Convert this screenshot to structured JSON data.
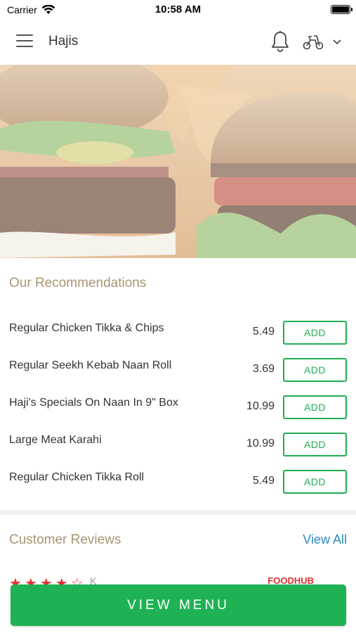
{
  "status_bar": {
    "carrier": "Carrier",
    "time": "10:58 AM",
    "battery_level": 1.0
  },
  "header": {
    "title": "Hajis",
    "icons": [
      "menu-icon",
      "bell-icon",
      "scooter-icon",
      "chevron-down-icon"
    ]
  },
  "recommendations": {
    "title": "Our Recommendations",
    "add_label": "ADD",
    "items": [
      {
        "name": "Regular Chicken Tikka & Chips",
        "price": "5.49"
      },
      {
        "name": "Regular Seekh Kebab Naan Roll",
        "price": "3.69"
      },
      {
        "name": "Haji's Specials On Naan In 9\" Box",
        "price": "10.99"
      },
      {
        "name": "Large Meat Karahi",
        "price": "10.99"
      },
      {
        "name": "Regular Chicken Tikka Roll",
        "price": "5.49"
      }
    ]
  },
  "reviews": {
    "title": "Customer Reviews",
    "view_all": "View All",
    "peek_stars": "★★★★☆",
    "peek_name": "K",
    "peek_tag": "FOODHUB"
  },
  "footer": {
    "view_menu": "VIEW MENU"
  },
  "colors": {
    "accent_green": "#1fb254",
    "section_title": "#a89572",
    "link_blue": "#2b8cc4",
    "star_red": "#e03131"
  }
}
